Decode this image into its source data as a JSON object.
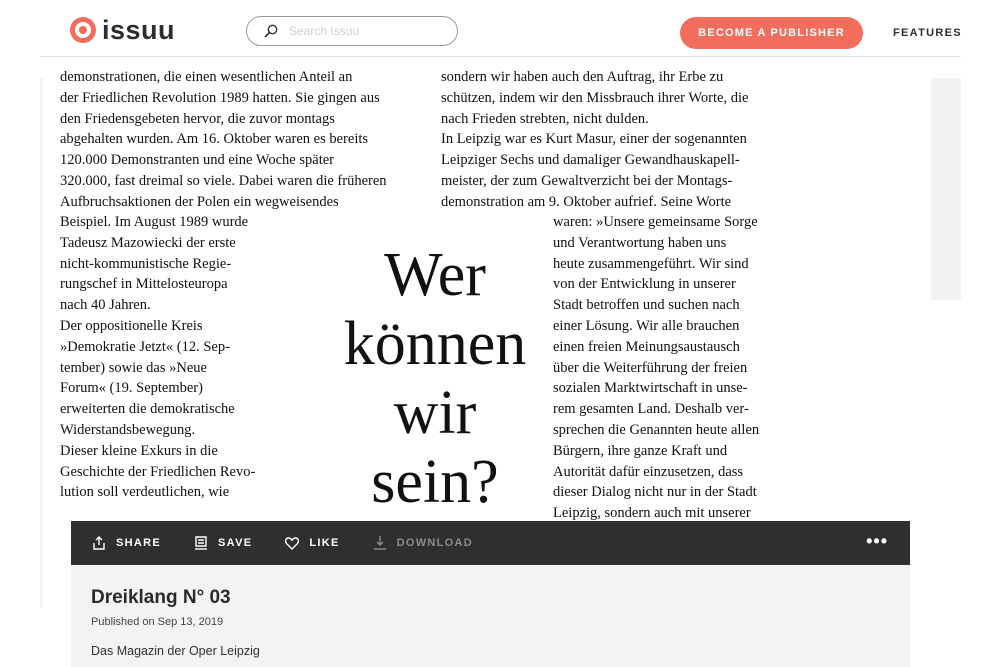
{
  "header": {
    "logo_text": "issuu",
    "search_placeholder": "Search Issuu",
    "publish_button": "BECOME A PUBLISHER",
    "features_link": "FEATURES"
  },
  "document": {
    "col_a": [
      "demonstrationen, die einen wesentlichen Anteil an",
      "der Friedlichen Revolution 1989 hatten. Sie gingen aus",
      "den Friedensgebeten hervor, die zuvor montags",
      "abgehalten wurden. Am 16. Oktober waren es bereits",
      "120.000 Demonstranten und eine Woche später",
      "320.000, fast dreimal so viele. Dabei waren die früheren",
      "Aufbruchsaktionen der Polen ein wegweisendes"
    ],
    "col_b": [
      "Beispiel. Im August 1989 wurde",
      "Tadeusz Mazowiecki der erste",
      "nicht-kommunistische Regie-",
      "rungschef in Mittelosteuropa",
      "nach 40 Jahren.",
      "Der oppositionelle Kreis",
      "»Demokratie Jetzt« (12. Sep-",
      "tember) sowie das »Neue",
      "Forum« (19. September)",
      "erweiterten die demokratische",
      "Widerstandsbewegung.",
      " ",
      "Dieser kleine Exkurs in die",
      "Geschichte der Friedlichen Revo-",
      "lution soll verdeutlichen, wie"
    ],
    "col_c": [
      "sondern wir haben auch den Auftrag, ihr Erbe zu",
      "schützen, indem wir den Missbrauch ihrer Worte, die",
      "nach Frieden strebten, nicht dulden.",
      "In Leipzig war es Kurt Masur, einer der sogenannten",
      "Leipziger Sechs und damaliger Gewandhauskapell-",
      "meister, der zum Gewaltverzicht bei der Montags-",
      "demonstration am 9. Oktober aufrief. Seine Worte"
    ],
    "col_d": [
      "waren: »Unsere gemeinsame Sorge",
      "und Verantwortung haben uns",
      "heute zusammengeführt. Wir sind",
      "von der Entwicklung in unserer",
      "Stadt betroffen und suchen nach",
      "einer Lösung. Wir alle brauchen",
      "einen freien Meinungsaustausch",
      "über die Weiterführung der freien",
      "sozialen Marktwirtschaft in unse-",
      "rem gesamten Land. Deshalb ver-",
      "sprechen die Genannten heute allen",
      "Bürgern, ihre ganze Kraft und",
      "Autorität dafür einzusetzen, dass",
      "dieser Dialog nicht nur in der Stadt",
      "Leipzig, sondern auch mit unserer"
    ],
    "headline": [
      "Wer",
      "können",
      "wir",
      "sein?"
    ]
  },
  "toolbar": {
    "share": "SHARE",
    "save": "SAVE",
    "like": "LIKE",
    "download": "DOWNLOAD",
    "more": "•••"
  },
  "info": {
    "title": "Dreiklang N° 03",
    "published": "Published on Sep 13, 2019",
    "description": "Das Magazin der Oper Leipzig"
  },
  "colors": {
    "accent": "#f36d5d",
    "toolbar_bg": "#2f2f2f",
    "panel_bg": "#f3f3f3"
  }
}
